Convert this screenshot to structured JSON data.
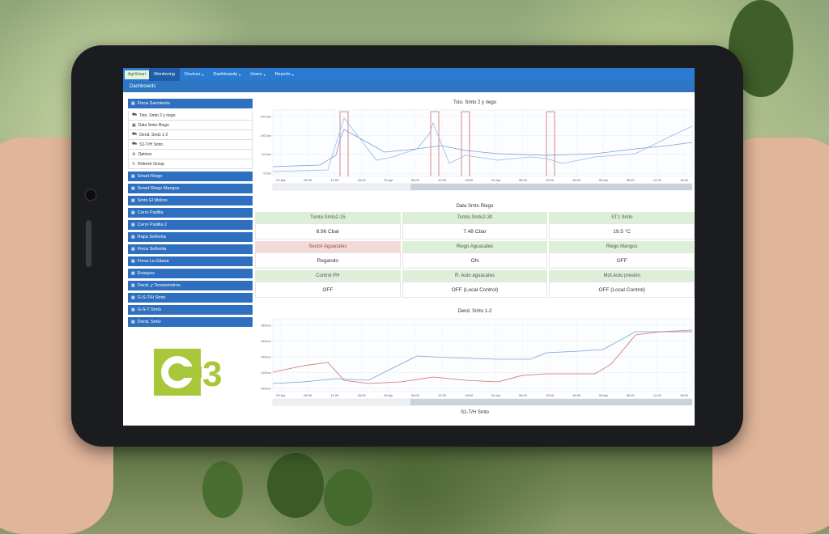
{
  "app": {
    "brand": "AgriSmart",
    "nav": [
      {
        "label": "Monitoring",
        "active": true,
        "dropdown": false
      },
      {
        "label": "Devices",
        "active": false,
        "dropdown": true
      },
      {
        "label": "Dashboards",
        "active": false,
        "dropdown": true
      },
      {
        "label": "Users",
        "active": false,
        "dropdown": true
      },
      {
        "label": "Reports",
        "active": false,
        "dropdown": true
      }
    ],
    "page_title": "Dashboards"
  },
  "sidebar": {
    "expanded_group": {
      "label": "Finca Sarmiento",
      "items": [
        {
          "label": "Tsto. Smto 2 y riego",
          "icon": "truck-icon"
        },
        {
          "label": "Data Smto Riego",
          "icon": "grid-icon"
        },
        {
          "label": "Dend. Smto 1-2",
          "icon": "truck-icon"
        },
        {
          "label": "S1-T/H Smto",
          "icon": "truck-icon"
        },
        {
          "label": "Options",
          "icon": "gear-icon"
        },
        {
          "label": "Refresh Group",
          "icon": "refresh-icon"
        }
      ]
    },
    "groups": [
      "Smart Riego",
      "Smart Riego Mangos",
      "Smto El Molino",
      "Cerro Padilla",
      "Cerro Padilla 2",
      "Rapa Señorita",
      "Finca Señorita",
      "Finca La Gitana",
      "Ensayos",
      "Dend. y Tensiometros",
      "G-S-T/H Smto",
      "G-S-T Smto",
      "Dend. Smto"
    ]
  },
  "chart1": {
    "title": "Tsto. Smto 2 y riego",
    "x_ticks": [
      "02 Apr",
      "06:00",
      "12:00",
      "18:00",
      "03 Apr",
      "06:00",
      "12:00",
      "18:00",
      "04 Apr",
      "06:00",
      "12:00",
      "18:00",
      "05 Apr",
      "06:00",
      "12:00",
      "18:00"
    ],
    "y_ticks": [
      "150Cbar",
      "100Cbar",
      "50Cbar",
      "0Cbar"
    ]
  },
  "data_title": "Data Smto Riego",
  "tiles": [
    [
      {
        "label": "Tsmto.Smto2-15",
        "value": "8.96 Cbar",
        "alert": false
      },
      {
        "label": "Tsmto.Smto2-30",
        "value": "7.48 Cbar",
        "alert": false
      },
      {
        "label": "ST1 Smto",
        "value": "19.5 °C",
        "alert": false
      }
    ],
    [
      {
        "label": "Sector Aguacates",
        "value": "Regando",
        "alert": true
      },
      {
        "label": "Riego Aguacates",
        "value": "ON",
        "alert": false
      },
      {
        "label": "Riego Mangos",
        "value": "OFF",
        "alert": false
      }
    ],
    [
      {
        "label": "Control PH",
        "value": "OFF",
        "alert": false
      },
      {
        "label": "R. Auto aguacates",
        "value": "OFF (Local Control)",
        "alert": false
      },
      {
        "label": "Mot.Auto presión",
        "value": "OFF (Local Control)",
        "alert": false
      }
    ]
  ],
  "chart2": {
    "title": "Dend. Smto 1-2",
    "x_ticks": [
      "02 Apr",
      "06:00",
      "12:00",
      "18:00",
      "03 Apr",
      "06:00",
      "12:00",
      "18:00",
      "04 Apr",
      "06:00",
      "12:00",
      "18:00",
      "05 Apr",
      "06:00",
      "12:00",
      "18:00"
    ],
    "y_ticks": [
      "4800um",
      "4600um",
      "4400um",
      "4200um",
      "4000um"
    ]
  },
  "bottom_title": "S1-T/H Smto",
  "logo_text": "C3",
  "colors": {
    "nav_blue": "#2a7ad2",
    "sidebar_blue": "#2f6fbf",
    "tile_green": "#ddefd9",
    "tile_alert": "#f4d9d9",
    "series_blue": "#7aa0d8",
    "series_red": "#d46a6a",
    "logo_green": "#a8c73a"
  }
}
